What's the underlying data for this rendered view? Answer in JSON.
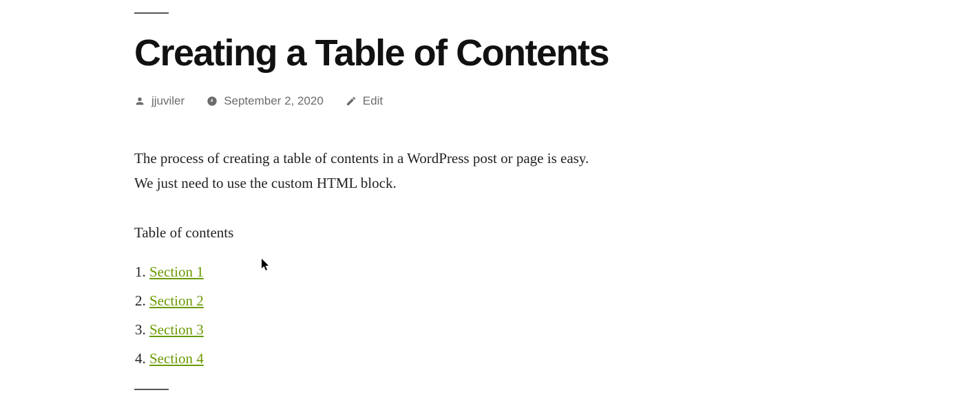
{
  "post": {
    "title": "Creating a Table of Contents",
    "meta": {
      "author": "jjuviler",
      "date": "September 2, 2020",
      "edit": "Edit"
    },
    "intro": "The process of creating a table of contents in a WordPress post or page is easy. We just need to use the custom HTML block.",
    "toc_label": "Table of contents",
    "toc_items": [
      "Section 1",
      "Section 2",
      "Section 3",
      "Section 4"
    ]
  }
}
